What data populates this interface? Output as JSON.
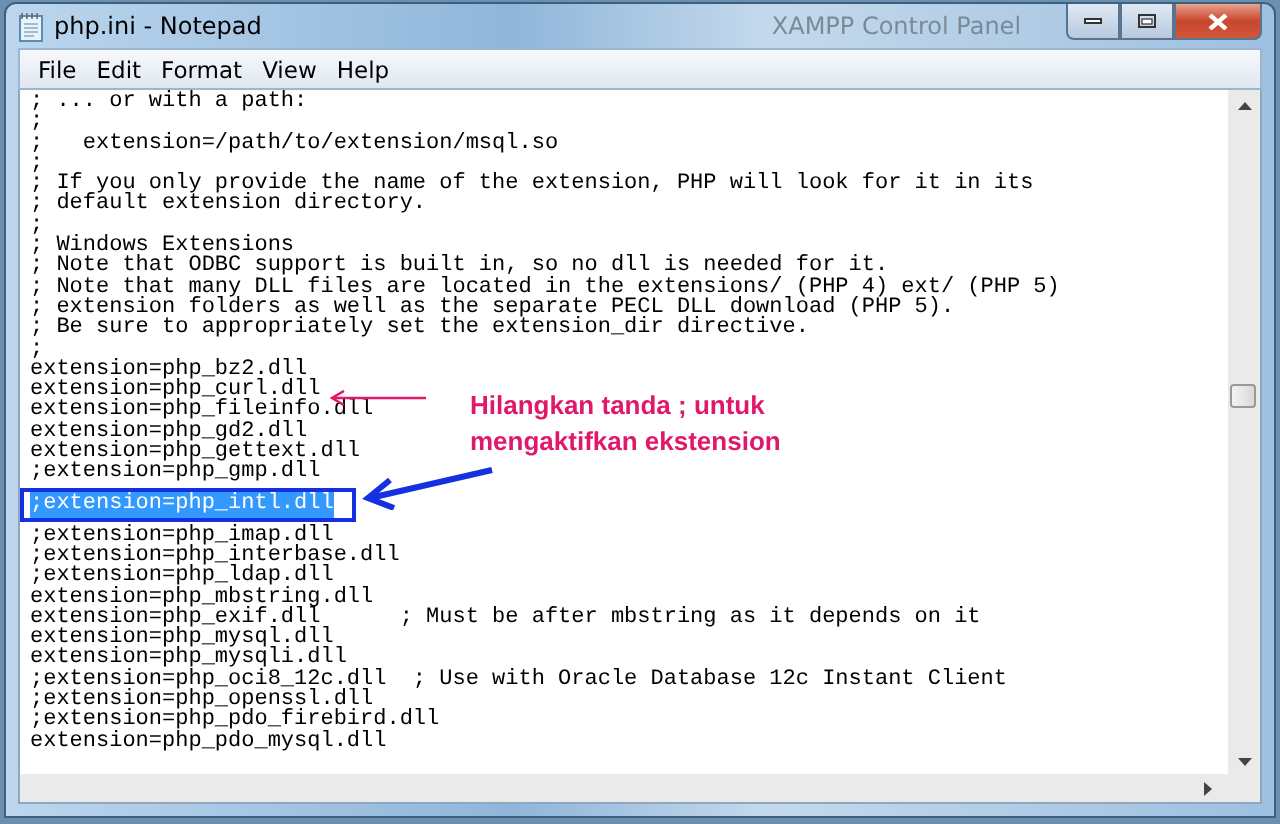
{
  "window": {
    "title": "php.ini - Notepad",
    "background_title": "XAMPP Control Panel"
  },
  "menu": [
    {
      "label": "File"
    },
    {
      "label": "Edit"
    },
    {
      "label": "Format"
    },
    {
      "label": "View"
    },
    {
      "label": "Help"
    }
  ],
  "editor": {
    "lines": [
      {
        "text": "; ... or with a path:",
        "selected": false
      },
      {
        "text": ";",
        "selected": false
      },
      {
        "text": ";   extension=/path/to/extension/msql.so",
        "selected": false
      },
      {
        "text": ";",
        "selected": false
      },
      {
        "text": "; If you only provide the name of the extension, PHP will look for it in its",
        "selected": false
      },
      {
        "text": "; default extension directory.",
        "selected": false
      },
      {
        "text": ";",
        "selected": false
      },
      {
        "text": "; Windows Extensions",
        "selected": false
      },
      {
        "text": "; Note that ODBC support is built in, so no dll is needed for it.",
        "selected": false
      },
      {
        "text": "; Note that many DLL files are located in the extensions/ (PHP 4) ext/ (PHP 5)",
        "selected": false
      },
      {
        "text": "; extension folders as well as the separate PECL DLL download (PHP 5).",
        "selected": false
      },
      {
        "text": "; Be sure to appropriately set the extension_dir directive.",
        "selected": false
      },
      {
        "text": ";",
        "selected": false
      },
      {
        "text": "extension=php_bz2.dll",
        "selected": false
      },
      {
        "text": "extension=php_curl.dll",
        "selected": false
      },
      {
        "text": "extension=php_fileinfo.dll",
        "selected": false
      },
      {
        "text": "extension=php_gd2.dll",
        "selected": false
      },
      {
        "text": "extension=php_gettext.dll",
        "selected": false
      },
      {
        "text": ";extension=php_gmp.dll",
        "selected": false
      },
      {
        "text": ";extension=php_intl.dll",
        "selected": true
      },
      {
        "text": ";extension=php_imap.dll",
        "selected": false
      },
      {
        "text": ";extension=php_interbase.dll",
        "selected": false
      },
      {
        "text": ";extension=php_ldap.dll",
        "selected": false
      },
      {
        "text": "extension=php_mbstring.dll",
        "selected": false
      },
      {
        "text": "extension=php_exif.dll      ; Must be after mbstring as it depends on it",
        "selected": false
      },
      {
        "text": "extension=php_mysql.dll",
        "selected": false
      },
      {
        "text": "extension=php_mysqli.dll",
        "selected": false
      },
      {
        "text": ";extension=php_oci8_12c.dll  ; Use with Oracle Database 12c Instant Client",
        "selected": false
      },
      {
        "text": ";extension=php_openssl.dll",
        "selected": false
      },
      {
        "text": ";extension=php_pdo_firebird.dll",
        "selected": false
      },
      {
        "text": "extension=php_pdo_mysql.dll",
        "selected": false
      }
    ]
  },
  "annotation": {
    "text": "Hilangkan tanda ; untuk mengaktifkan ekstension"
  }
}
